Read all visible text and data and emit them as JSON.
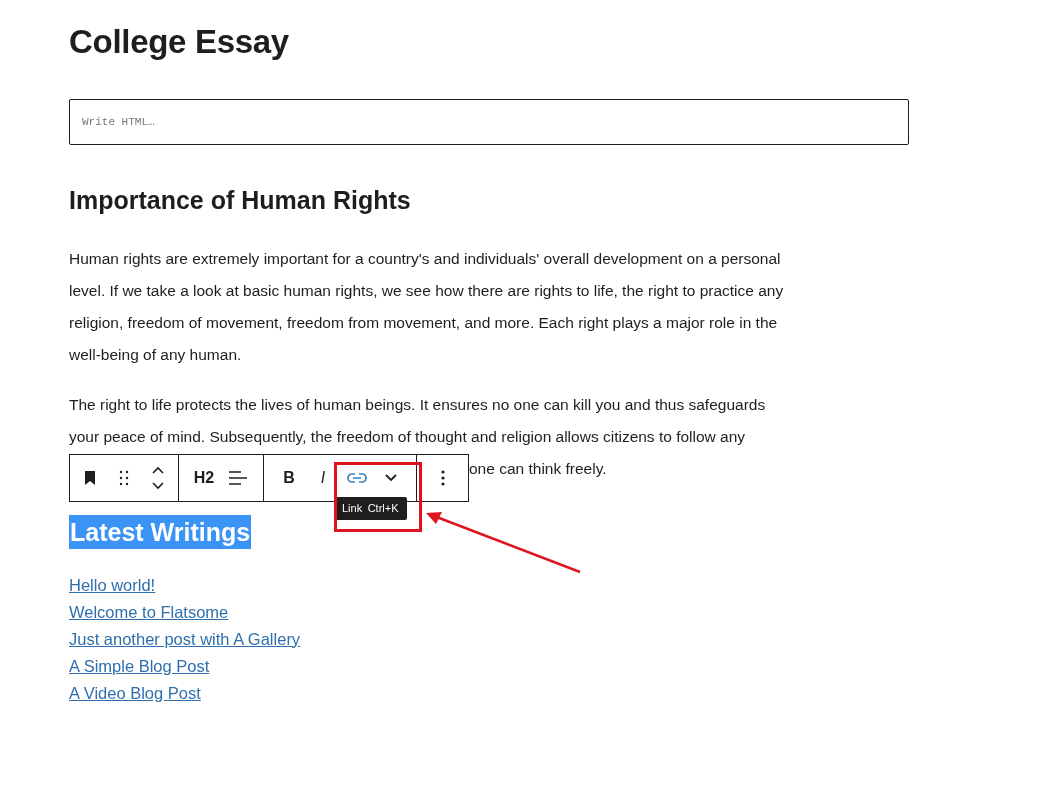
{
  "title": "College Essay",
  "html_block": {
    "placeholder": "Write HTML…"
  },
  "heading": "Importance of Human Rights",
  "paragraphs": [
    {
      "lines": [
        "Human rights are extremely important for a country's and individuals' overall development on a personal",
        "level. If we take a look at basic human rights, we see how there are rights to life, the right to practice any",
        "religion, freedom of movement, freedom from movement, and more. Each right plays a major role in the",
        "well-being of any human."
      ]
    },
    {
      "lines": [
        "The right to life protects the lives of human beings. It ensures no one can kill you and thus safeguards",
        "your peace of mind. Subsequently, the freedom of thought and religion allows citizens to follow any",
        "one can think freely."
      ]
    }
  ],
  "toolbar": {
    "groups": [
      [
        {
          "kind": "bookmark"
        },
        {
          "kind": "drag"
        },
        {
          "kind": "move"
        }
      ],
      [
        {
          "kind": "text",
          "label": "H2"
        },
        {
          "kind": "align"
        }
      ],
      [
        {
          "kind": "bold",
          "label": "B"
        },
        {
          "kind": "italic",
          "label": "I"
        },
        {
          "kind": "link",
          "active": true
        },
        {
          "kind": "chevron"
        }
      ],
      [
        {
          "kind": "more"
        }
      ]
    ],
    "tooltip": {
      "label": "Link",
      "shortcut": "Ctrl+K"
    }
  },
  "selected_heading": {
    "text": "Latest Writings",
    "selected": true
  },
  "links": [
    "Hello world!",
    "Welcome to Flatsome",
    "Just another post with A Gallery",
    "A Simple Blog Post",
    "A Video Blog Post"
  ]
}
